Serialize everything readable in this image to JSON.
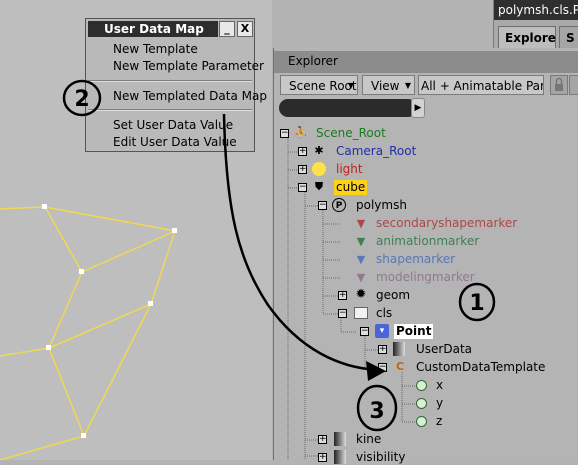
{
  "top_window": {
    "title": "polymsh.cls.Point",
    "tabs": [
      "Explore",
      "S"
    ]
  },
  "popup": {
    "title": "User Data Map",
    "min_label": "_",
    "close_label": "X",
    "items": [
      "New Template",
      "New Template Parameter",
      "New Templated Data Map",
      "Set User Data Value",
      "Edit User Data Value"
    ]
  },
  "explorer": {
    "title": "Explorer",
    "scope": "Scene Root",
    "view": "View",
    "filter": "All + Animatable Params"
  },
  "tree": [
    {
      "label": "Scene_Root",
      "color": "#1d7a1d"
    },
    {
      "label": "Camera_Root",
      "color": "#1f2fa8"
    },
    {
      "label": "light",
      "color": "#c02323"
    },
    {
      "label": "cube",
      "color": "#000000",
      "highlight": "#ffd21a"
    },
    {
      "label": "polymsh",
      "color": "#000000"
    },
    {
      "label": "secondaryshapemarker",
      "color": "#b04646"
    },
    {
      "label": "animationmarker",
      "color": "#3e7f52"
    },
    {
      "label": "shapemarker",
      "color": "#5578b8"
    },
    {
      "label": "modelingmarker",
      "color": "#8e7a8e"
    },
    {
      "label": "geom",
      "color": "#000000"
    },
    {
      "label": "cls",
      "color": "#000000"
    },
    {
      "label": "Point",
      "color": "#000000",
      "highlight": "#ffffff"
    },
    {
      "label": "UserData",
      "color": "#000000"
    },
    {
      "label": "CustomDataTemplate",
      "color": "#000000"
    },
    {
      "label": "x",
      "color": "#000000"
    },
    {
      "label": "y",
      "color": "#000000"
    },
    {
      "label": "z",
      "color": "#000000"
    },
    {
      "label": "kine",
      "color": "#000000"
    },
    {
      "label": "visibility",
      "color": "#000000"
    }
  ],
  "annotations": [
    "1",
    "2",
    "3"
  ],
  "colors": {
    "wireframe": "#f0d850",
    "title_bar": "#2d2d2d",
    "panel": "#b4b4b4"
  }
}
